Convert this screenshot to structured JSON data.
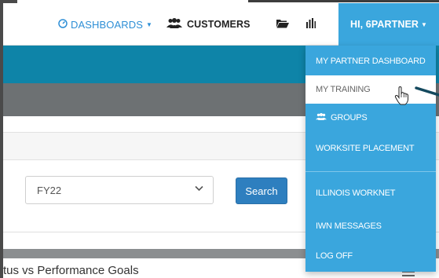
{
  "navbar": {
    "dashboards_label": "DASHBOARDS",
    "customers_label": "CUSTOMERS",
    "user_label": "HI, 6PARTNER"
  },
  "filter": {
    "selected_year": "FY22",
    "search_label": "Search"
  },
  "section": {
    "title": "tus vs Performance Goals"
  },
  "dropdown": {
    "items": [
      {
        "label": "MY PARTNER DASHBOARD"
      },
      {
        "label": "MY TRAINING"
      },
      {
        "label": "GROUPS"
      },
      {
        "label": "WORKSITE PLACEMENT"
      },
      {
        "label": "ILLINOIS WORKNET"
      },
      {
        "label": "IWN MESSAGES"
      },
      {
        "label": "LOG OFF"
      }
    ]
  },
  "colors": {
    "accent_blue": "#3aa6dd",
    "teal_band": "#0e84a8",
    "gray_band": "#6d7173",
    "search_button": "#2e7fbf"
  },
  "icons": {
    "dashboards": "dashboard-gauge-icon",
    "customers": "users-icon",
    "folder": "folder-open-icon",
    "chart": "bar-chart-icon",
    "groups": "users-icon",
    "cursor": "hand-pointer-icon"
  }
}
